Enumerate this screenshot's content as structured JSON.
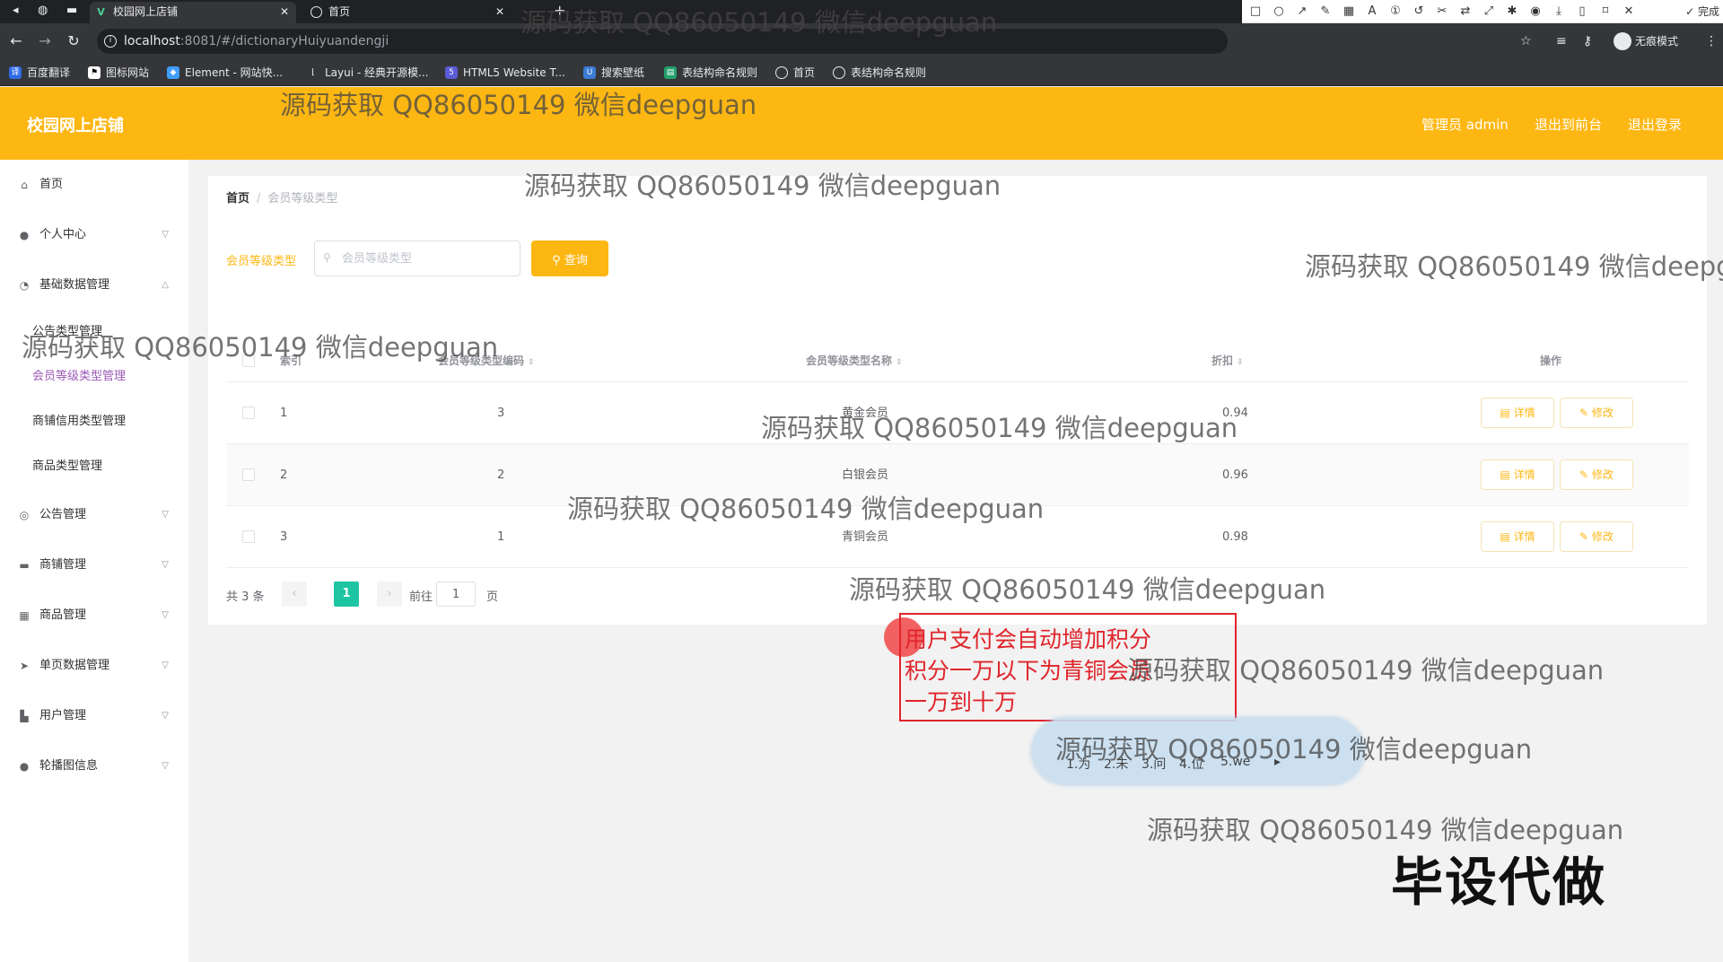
{
  "browser": {
    "tabs": [
      {
        "title": "校园网上店铺",
        "active": true
      },
      {
        "title": "首页",
        "active": false
      }
    ],
    "url_host": "localhost",
    "url_path": ":8081/#/dictionaryHuiyuandengji",
    "profile_label": "无痕模式",
    "bookmarks": [
      "百度翻译",
      "图标网站",
      "Element - 网站快...",
      "Layui - 经典开源模...",
      "HTML5 Website T...",
      "搜索壁纸",
      "表结构命名规则",
      "首页",
      "表结构命名规则"
    ]
  },
  "annotation_toolbar": {
    "done_label": "完成",
    "font_size": "20",
    "current_color": "#f43b3b"
  },
  "header": {
    "title": "校园网上店铺",
    "user_label": "管理员 admin",
    "back_label": "退出到前台",
    "logout_label": "退出登录",
    "accent_color": "#fdb713"
  },
  "sidebar": {
    "items": [
      {
        "label": "首页"
      },
      {
        "label": "个人中心"
      },
      {
        "label": "基础数据管理"
      },
      {
        "label": "公告类型管理"
      },
      {
        "label": "会员等级类型管理"
      },
      {
        "label": "商铺信用类型管理"
      },
      {
        "label": "商品类型管理"
      },
      {
        "label": "公告管理"
      },
      {
        "label": "商铺管理"
      },
      {
        "label": "商品管理"
      },
      {
        "label": "单页数据管理"
      },
      {
        "label": "用户管理"
      },
      {
        "label": "轮播图信息"
      }
    ],
    "active_color": "#9b59b6"
  },
  "breadcrumb": {
    "home": "首页",
    "current": "会员等级类型"
  },
  "search": {
    "label": "会员等级类型",
    "placeholder": "会员等级类型",
    "button_label": "查询"
  },
  "table": {
    "columns": [
      "索引",
      "会员等级类型编码",
      "会员等级类型名称",
      "折扣",
      "操作"
    ],
    "rows": [
      {
        "index": "1",
        "code": "3",
        "name": "黄金会员",
        "discount": "0.94"
      },
      {
        "index": "2",
        "code": "2",
        "name": "白银会员",
        "discount": "0.96"
      },
      {
        "index": "3",
        "code": "1",
        "name": "青铜会员",
        "discount": "0.98"
      }
    ],
    "detail_label": "详情",
    "edit_label": "修改"
  },
  "pagination": {
    "total_label": "共 3 条",
    "current_page": "1",
    "goto_label": "前往",
    "goto_value": "1",
    "page_suffix": "页"
  },
  "overlays": {
    "watermark": "源码获取 QQ86050149 微信deepguan",
    "note_lines": [
      "用户支付会自动增加积分",
      "积分一万以下为青铜会员",
      "一万到十万"
    ],
    "ime_candidates": [
      "1.为",
      "2.未",
      "3.问",
      "4.位",
      "5.we"
    ],
    "stamp": "毕设代做"
  }
}
